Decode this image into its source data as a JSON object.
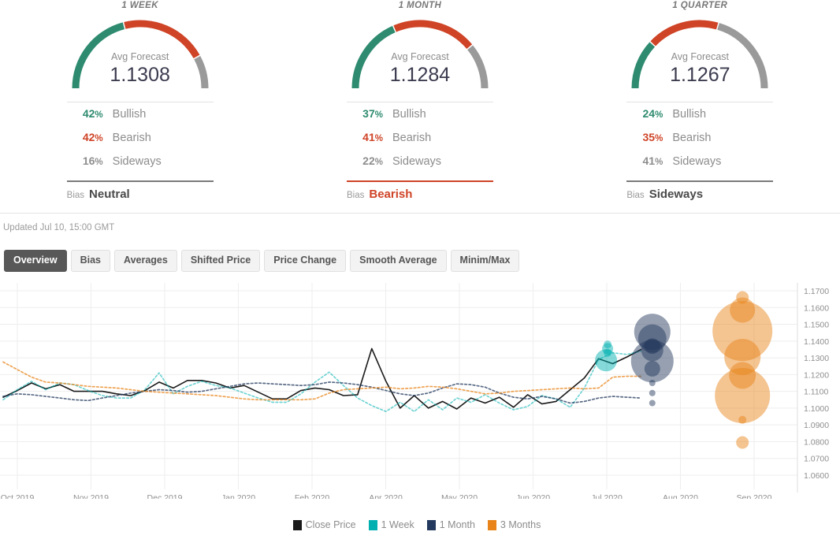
{
  "gauges": [
    {
      "title": "1 WEEK",
      "forecast_label": "Avg Forecast",
      "forecast_value": "1.1308",
      "stats": [
        {
          "pct": "42",
          "sign": "%",
          "name": "Bullish"
        },
        {
          "pct": "42",
          "sign": "%",
          "name": "Bearish"
        },
        {
          "pct": "16",
          "sign": "%",
          "name": "Sideways"
        }
      ],
      "bias_label": "Bias",
      "bias_value": "Neutral",
      "bias_color": "#4a4a4a",
      "arc": {
        "green": 42,
        "red": 42,
        "gray": 16
      }
    },
    {
      "title": "1 MONTH",
      "forecast_label": "Avg Forecast",
      "forecast_value": "1.1284",
      "stats": [
        {
          "pct": "37",
          "sign": "%",
          "name": "Bullish"
        },
        {
          "pct": "41",
          "sign": "%",
          "name": "Bearish"
        },
        {
          "pct": "22",
          "sign": "%",
          "name": "Sideways"
        }
      ],
      "bias_label": "Bias",
      "bias_value": "Bearish",
      "bias_color": "#cf4427",
      "arc": {
        "green": 37,
        "red": 41,
        "gray": 22
      }
    },
    {
      "title": "1 QUARTER",
      "forecast_label": "Avg Forecast",
      "forecast_value": "1.1267",
      "stats": [
        {
          "pct": "24",
          "sign": "%",
          "name": "Bullish"
        },
        {
          "pct": "35",
          "sign": "%",
          "name": "Bearish"
        },
        {
          "pct": "41",
          "sign": "%",
          "name": "Sideways"
        }
      ],
      "bias_label": "Bias",
      "bias_value": "Sideways",
      "bias_color": "#4a4a4a",
      "arc": {
        "green": 24,
        "red": 35,
        "gray": 41
      }
    }
  ],
  "updated_text": "Updated Jul 10, 15:00 GMT",
  "tabs": [
    {
      "label": "Overview",
      "active": true
    },
    {
      "label": "Bias",
      "active": false
    },
    {
      "label": "Averages",
      "active": false
    },
    {
      "label": "Shifted Price",
      "active": false
    },
    {
      "label": "Price Change",
      "active": false
    },
    {
      "label": "Smooth Average",
      "active": false
    },
    {
      "label": "Minim/Max",
      "active": false
    }
  ],
  "colors": {
    "bullish": "#2e8b6f",
    "bearish": "#cf4427",
    "sideways": "#9a9a9a",
    "close_price": "#1a1a1a",
    "one_week": "#00b0b0",
    "one_month": "#23395d",
    "three_months": "#e8841a",
    "tab_active_bg": "#585858",
    "grid": "#eeeeee"
  },
  "chart_data": {
    "type": "line",
    "title": "",
    "xlabel": "",
    "ylabel": "",
    "ylim": [
      1.06,
      1.17
    ],
    "yticks": [
      "1.1700",
      "1.1600",
      "1.1500",
      "1.1400",
      "1.1300",
      "1.1200",
      "1.1100",
      "1.1000",
      "1.0900",
      "1.0800",
      "1.0700",
      "1.0600"
    ],
    "xticks": [
      "Oct 2019",
      "Nov 2019",
      "Dec 2019",
      "Jan 2020",
      "Feb 2020",
      "Apr 2020",
      "May 2020",
      "Jun 2020",
      "Jul 2020",
      "Aug 2020",
      "Sep 2020"
    ],
    "grid": true,
    "legend_position": "bottom",
    "legend": [
      "Close Price",
      "1 Week",
      "1 Month",
      "3 Months"
    ],
    "series": [
      {
        "name": "Close Price",
        "color": "#1a1a1a",
        "style": "solid",
        "values": [
          1.1065,
          1.1105,
          1.115,
          1.1115,
          1.114,
          1.11,
          1.11,
          1.11,
          1.1085,
          1.1075,
          1.1105,
          1.1155,
          1.112,
          1.1165,
          1.1165,
          1.115,
          1.112,
          1.1135,
          1.1095,
          1.1055,
          1.1055,
          1.1105,
          1.112,
          1.111,
          1.1075,
          1.108,
          1.1355,
          1.116,
          1.1,
          1.1075,
          1.1,
          1.104,
          1.0995,
          1.106,
          1.103,
          1.1065,
          1.1005,
          1.108,
          1.1025,
          1.104,
          1.111,
          1.118,
          1.1295,
          1.1265,
          1.1305,
          1.135
        ]
      },
      {
        "name": "1 Week",
        "color": "#00b0b0",
        "style": "dotted",
        "values": [
          1.105,
          1.111,
          1.116,
          1.111,
          1.115,
          1.114,
          1.1105,
          1.1075,
          1.106,
          1.106,
          1.111,
          1.121,
          1.1085,
          1.113,
          1.116,
          1.1135,
          1.112,
          1.109,
          1.106,
          1.1035,
          1.1035,
          1.1085,
          1.1155,
          1.1215,
          1.1135,
          1.106,
          1.1015,
          1.098,
          1.1035,
          1.098,
          1.105,
          1.099,
          1.106,
          1.1035,
          1.108,
          1.103,
          1.099,
          1.101,
          1.1075,
          1.1055,
          1.1005,
          1.112,
          1.129,
          1.133,
          1.132,
          1.134
        ]
      },
      {
        "name": "1 Month",
        "color": "#23395d",
        "style": "dotted",
        "values": [
          1.107,
          1.1085,
          1.108,
          1.107,
          1.106,
          1.105,
          1.1045,
          1.106,
          1.1075,
          1.109,
          1.11,
          1.111,
          1.1105,
          1.1095,
          1.11,
          1.1115,
          1.113,
          1.1145,
          1.115,
          1.1145,
          1.114,
          1.1135,
          1.114,
          1.1155,
          1.115,
          1.114,
          1.1125,
          1.1105,
          1.1085,
          1.1075,
          1.109,
          1.112,
          1.1145,
          1.114,
          1.1125,
          1.109,
          1.1065,
          1.1055,
          1.107,
          1.1055,
          1.103,
          1.104,
          1.106,
          1.107,
          1.1065,
          1.106
        ]
      },
      {
        "name": "3 Months",
        "color": "#e8841a",
        "style": "dotted",
        "values": [
          1.1275,
          1.123,
          1.1185,
          1.1155,
          1.115,
          1.114,
          1.113,
          1.1125,
          1.112,
          1.111,
          1.11,
          1.1095,
          1.109,
          1.1085,
          1.108,
          1.1075,
          1.1065,
          1.1055,
          1.105,
          1.105,
          1.105,
          1.105,
          1.1055,
          1.109,
          1.111,
          1.1115,
          1.112,
          1.1125,
          1.1115,
          1.112,
          1.113,
          1.1125,
          1.1115,
          1.11,
          1.1085,
          1.109,
          1.11,
          1.1105,
          1.111,
          1.1115,
          1.112,
          1.1115,
          1.112,
          1.1185,
          1.119,
          1.119
        ]
      }
    ],
    "bubbles": [
      {
        "series": "1 Week",
        "x": 0.762,
        "y": 1.138,
        "r": 5
      },
      {
        "series": "1 Week",
        "x": 0.762,
        "y": 1.1355,
        "r": 7
      },
      {
        "series": "1 Week",
        "x": 0.762,
        "y": 1.133,
        "r": 5
      },
      {
        "series": "1 Week",
        "x": 0.76,
        "y": 1.1285,
        "r": 14
      },
      {
        "series": "1 Month",
        "x": 0.818,
        "y": 1.1455,
        "r": 23
      },
      {
        "series": "1 Month",
        "x": 0.818,
        "y": 1.1415,
        "r": 18
      },
      {
        "series": "1 Month",
        "x": 0.818,
        "y": 1.137,
        "r": 10
      },
      {
        "series": "1 Month",
        "x": 0.818,
        "y": 1.1345,
        "r": 14
      },
      {
        "series": "1 Month",
        "x": 0.818,
        "y": 1.128,
        "r": 27
      },
      {
        "series": "1 Month",
        "x": 0.818,
        "y": 1.1235,
        "r": 10
      },
      {
        "series": "1 Month",
        "x": 0.818,
        "y": 1.115,
        "r": 4
      },
      {
        "series": "1 Month",
        "x": 0.818,
        "y": 1.109,
        "r": 4
      },
      {
        "series": "1 Month",
        "x": 0.818,
        "y": 1.103,
        "r": 4
      },
      {
        "series": "3 Months",
        "x": 0.931,
        "y": 1.166,
        "r": 8
      },
      {
        "series": "3 Months",
        "x": 0.931,
        "y": 1.1585,
        "r": 16
      },
      {
        "series": "3 Months",
        "x": 0.931,
        "y": 1.146,
        "r": 38
      },
      {
        "series": "3 Months",
        "x": 0.931,
        "y": 1.1305,
        "r": 23
      },
      {
        "series": "3 Months",
        "x": 0.931,
        "y": 1.1195,
        "r": 17
      },
      {
        "series": "3 Months",
        "x": 0.931,
        "y": 1.1075,
        "r": 35
      },
      {
        "series": "3 Months",
        "x": 0.931,
        "y": 1.093,
        "r": 5
      },
      {
        "series": "3 Months",
        "x": 0.931,
        "y": 1.0795,
        "r": 8
      }
    ]
  }
}
